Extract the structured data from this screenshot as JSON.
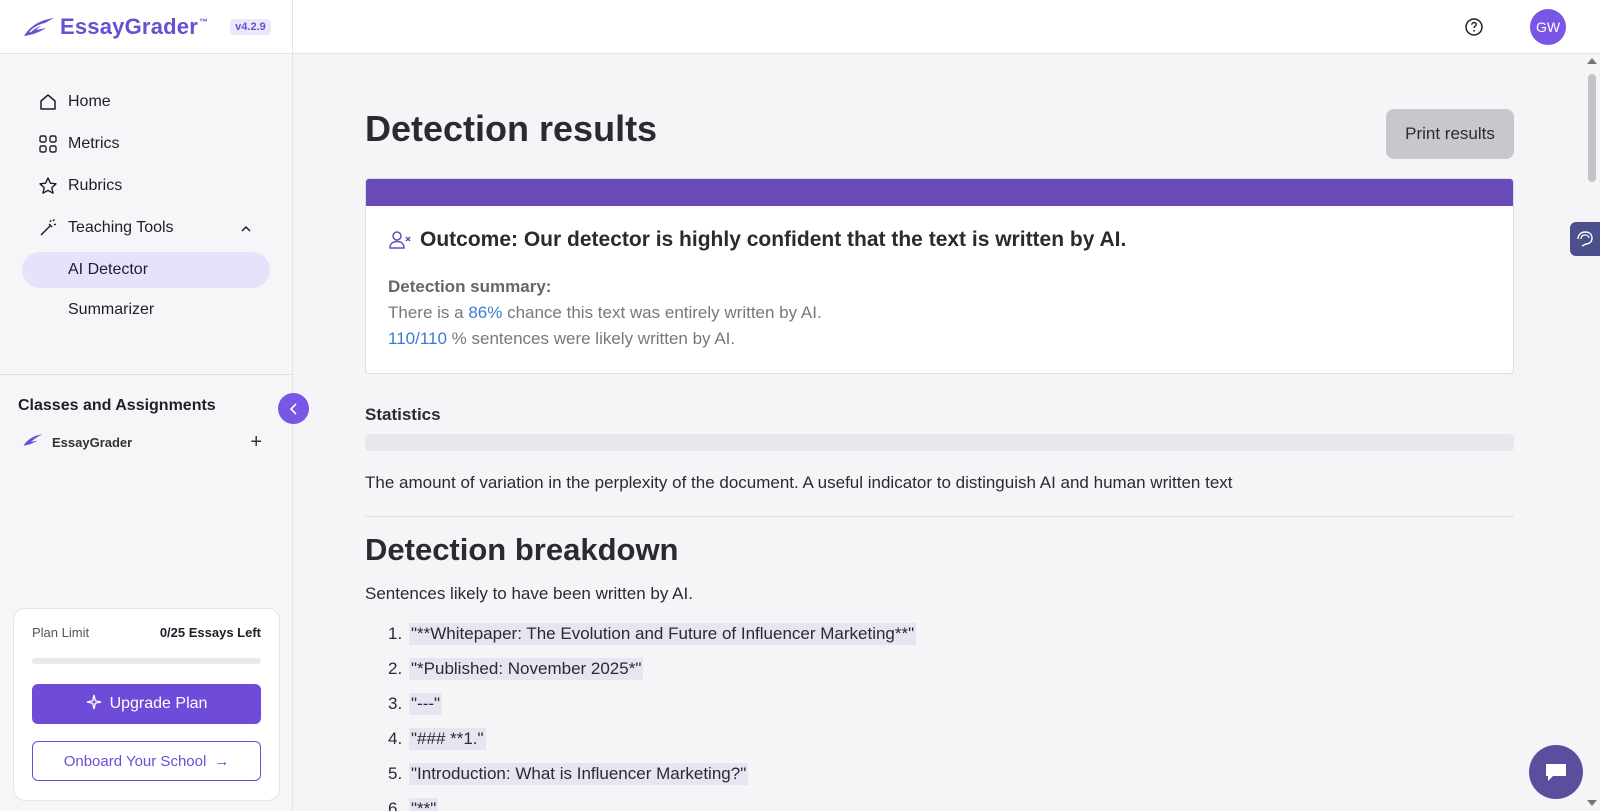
{
  "brand": {
    "name": "EssayGrader",
    "tm": "™",
    "version": "v4.2.9"
  },
  "sidebar": {
    "items": [
      {
        "label": "Home",
        "icon": "home-icon"
      },
      {
        "label": "Metrics",
        "icon": "grid-icon"
      },
      {
        "label": "Rubrics",
        "icon": "star-icon"
      },
      {
        "label": "Teaching Tools",
        "icon": "magic-wand-icon"
      }
    ],
    "sub_items": [
      {
        "label": "AI Detector",
        "active": true
      },
      {
        "label": "Summarizer",
        "active": false
      }
    ],
    "classes_title": "Classes and Assignments",
    "class_name": "EssayGrader",
    "plan": {
      "label": "Plan Limit",
      "value": "0/25 Essays Left",
      "upgrade_label": "Upgrade Plan",
      "onboard_label": "Onboard Your School"
    }
  },
  "topbar": {
    "avatar_initials": "GW"
  },
  "main": {
    "title": "Detection results",
    "print_label": "Print results",
    "outcome": {
      "heading": "Outcome: Our detector is highly confident that the text is written by AI.",
      "summary_label": "Detection summary:",
      "line1_pre": "There is a ",
      "line1_value": "86%",
      "line1_post": " chance this text was entirely written by AI.",
      "line2_value": "110/110",
      "line2_post": " % sentences were likely written by AI."
    },
    "statistics": {
      "title": "Statistics",
      "description": "The amount of variation in the perplexity of the document. A useful indicator to distinguish AI and human written text"
    },
    "breakdown": {
      "title": "Detection breakdown",
      "subtitle": "Sentences likely to have been written by AI.",
      "sentences": [
        "\"**Whitepaper: The Evolution and Future of Influencer Marketing**\"",
        "\"*Published: November 2025*\"",
        "\"---\"",
        "\"### **1.\"",
        "\"Introduction: What is Influencer Marketing?\"",
        "\"**\""
      ]
    }
  },
  "colors": {
    "accent": "#6e4bd8",
    "outcome_bar": "#6a4ab8",
    "highlight_link": "#3a7bd5"
  }
}
